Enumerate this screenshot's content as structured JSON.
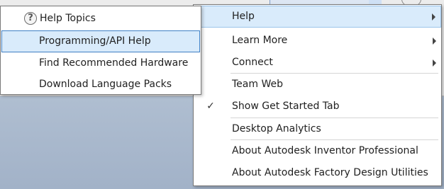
{
  "main_menu": {
    "items": [
      {
        "label": "Help",
        "has_submenu": true,
        "highlighted": true
      },
      {
        "label": "Learn More",
        "has_submenu": true
      },
      {
        "label": "Connect",
        "has_submenu": true
      },
      {
        "label": "Team Web"
      },
      {
        "label": "Show Get Started Tab",
        "checked": true
      },
      {
        "label": "Desktop Analytics"
      },
      {
        "label": "About Autodesk Inventor Professional"
      },
      {
        "label": "About Autodesk Factory Design Utilities"
      }
    ],
    "check_glyph": "✓"
  },
  "help_submenu": {
    "items": [
      {
        "label": "Help Topics",
        "icon": "help-question-icon"
      },
      {
        "label": "Programming/API Help",
        "highlighted": true
      },
      {
        "label": "Find Recommended Hardware"
      },
      {
        "label": "Download Language Packs"
      }
    ],
    "help_icon_glyph": "?"
  },
  "colors": {
    "highlight_bg": "#d9ebfb",
    "highlight_border": "#3e7fc4",
    "background": "#aebdd0"
  }
}
